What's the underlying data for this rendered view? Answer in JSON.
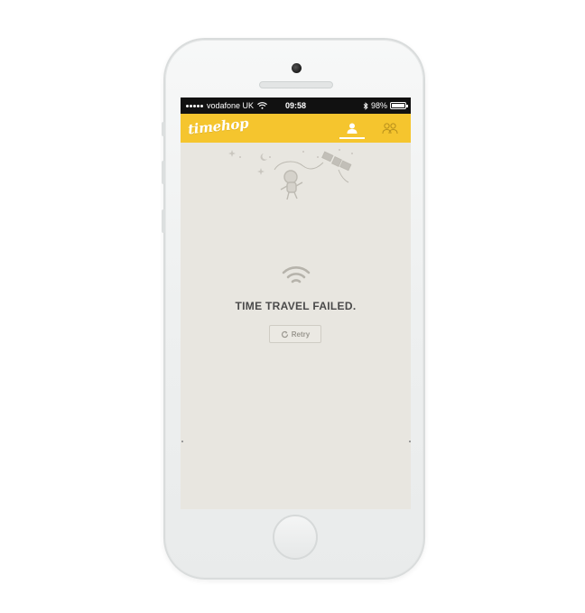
{
  "status_bar": {
    "carrier": "vodafone UK",
    "time": "09:58",
    "battery_percent": "98%",
    "battery_level": 0.98,
    "icons": [
      "signal-dots-icon",
      "wifi-icon",
      "bluetooth-icon",
      "battery-icon"
    ]
  },
  "app_bar": {
    "logo_text": "timehop",
    "accent_color": "#f5c52e",
    "tabs": [
      {
        "name": "me",
        "icon": "person-icon",
        "active": true
      },
      {
        "name": "friends",
        "icon": "people-icon",
        "active": false
      }
    ]
  },
  "error": {
    "icon": "wifi-icon",
    "title": "TIME TRAVEL FAILED.",
    "retry_label": "Retry",
    "retry_icon": "refresh-icon"
  },
  "colors": {
    "screen_bg": "#e8e6e0",
    "title_text": "#4a4a4a",
    "status_bar": "#111111"
  }
}
